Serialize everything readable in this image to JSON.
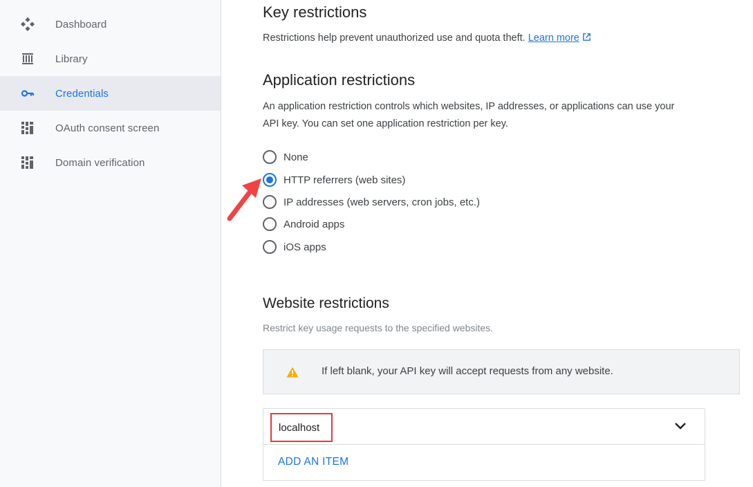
{
  "sidebar": {
    "items": [
      {
        "label": "Dashboard",
        "icon": "dashboard-icon",
        "active": false
      },
      {
        "label": "Library",
        "icon": "library-icon",
        "active": false
      },
      {
        "label": "Credentials",
        "icon": "key-icon",
        "active": true
      },
      {
        "label": "OAuth consent screen",
        "icon": "oauth-icon",
        "active": false
      },
      {
        "label": "Domain verification",
        "icon": "domain-icon",
        "active": false
      }
    ]
  },
  "key_restrictions": {
    "title": "Key restrictions",
    "description": "Restrictions help prevent unauthorized use and quota theft.",
    "learn_more": "Learn more"
  },
  "application_restrictions": {
    "title": "Application restrictions",
    "description_line1": "An application restriction controls which websites, IP addresses, or applications can use your",
    "description_line2": "API key. You can set one application restriction per key.",
    "options": [
      {
        "label": "None",
        "checked": false
      },
      {
        "label": "HTTP referrers (web sites)",
        "checked": true
      },
      {
        "label": "IP addresses (web servers, cron jobs, etc.)",
        "checked": false
      },
      {
        "label": "Android apps",
        "checked": false
      },
      {
        "label": "iOS apps",
        "checked": false
      }
    ]
  },
  "website_restrictions": {
    "title": "Website restrictions",
    "description": "Restrict key usage requests to the specified websites.",
    "warning": "If left blank, your API key will accept requests from any website.",
    "items": [
      "localhost"
    ],
    "add_item": "ADD AN ITEM"
  },
  "colors": {
    "accent": "#1a73e8",
    "warning": "#f9ab00",
    "highlight": "#e53935"
  }
}
